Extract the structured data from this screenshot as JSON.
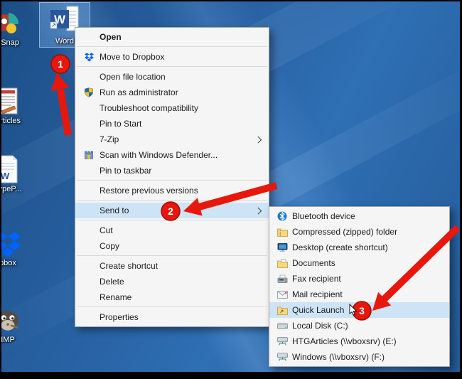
{
  "desktop": {
    "word_letter": "W",
    "icons": [
      {
        "name": "nsnap",
        "label": "nSnap"
      },
      {
        "name": "word",
        "label": "Word"
      },
      {
        "name": "articles",
        "label": "Articles"
      },
      {
        "name": "typep",
        "label": "TypeP..."
      },
      {
        "name": "dropbox",
        "label": "pbox"
      },
      {
        "name": "gimp",
        "label": "IMP"
      }
    ]
  },
  "context_menu": {
    "items": [
      {
        "label": "Open",
        "bold": true
      },
      {
        "label": "Move to Dropbox",
        "icon": "dropbox-icon"
      },
      {
        "label": "Open file location"
      },
      {
        "label": "Run as administrator",
        "icon": "uac-shield-icon"
      },
      {
        "label": "Troubleshoot compatibility"
      },
      {
        "label": "Pin to Start"
      },
      {
        "label": "7-Zip",
        "submenu": true
      },
      {
        "label": "Scan with Windows Defender...",
        "icon": "defender-icon"
      },
      {
        "label": "Pin to taskbar"
      },
      {
        "label": "Restore previous versions"
      },
      {
        "label": "Send to",
        "submenu": true,
        "highlighted": true
      },
      {
        "label": "Cut"
      },
      {
        "label": "Copy"
      },
      {
        "label": "Create shortcut"
      },
      {
        "label": "Delete"
      },
      {
        "label": "Rename"
      },
      {
        "label": "Properties"
      }
    ]
  },
  "send_to_submenu": {
    "items": [
      {
        "label": "Bluetooth device",
        "icon": "bluetooth-icon"
      },
      {
        "label": "Compressed (zipped) folder",
        "icon": "zip-folder-icon"
      },
      {
        "label": "Desktop (create shortcut)",
        "icon": "desktop-icon"
      },
      {
        "label": "Documents",
        "icon": "documents-icon"
      },
      {
        "label": "Fax recipient",
        "icon": "fax-icon"
      },
      {
        "label": "Mail recipient",
        "icon": "mail-icon"
      },
      {
        "label": "Quick Launch",
        "icon": "quick-launch-folder-icon",
        "highlighted": true
      },
      {
        "label": "Local Disk (C:)",
        "icon": "local-disk-icon"
      },
      {
        "label": "HTGArticles (\\\\vboxsrv) (E:)",
        "icon": "network-drive-icon"
      },
      {
        "label": "Windows (\\\\vboxsrv) (F:)",
        "icon": "network-drive-icon"
      }
    ]
  },
  "annotations": {
    "steps": [
      {
        "number": "1"
      },
      {
        "number": "2"
      },
      {
        "number": "3"
      }
    ]
  },
  "colors": {
    "annotation_red": "#e8170c",
    "menu_highlight": "#cde4f7",
    "desktop_blue": "#2a65a8"
  }
}
